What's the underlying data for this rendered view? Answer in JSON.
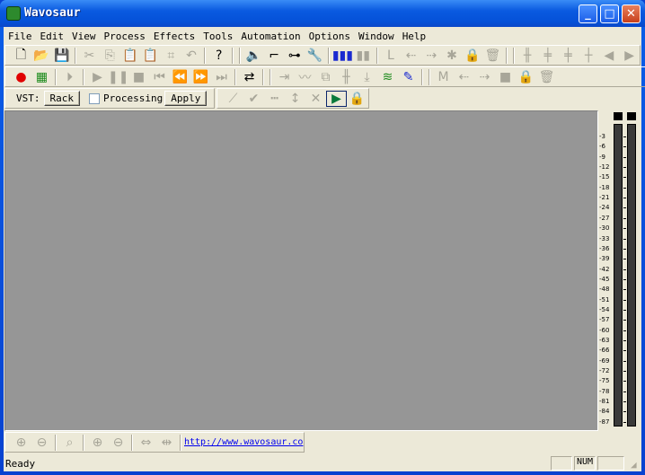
{
  "window": {
    "title": "Wavosaur",
    "minimize": "_",
    "maximize": "□",
    "close": "✕"
  },
  "menu": [
    "File",
    "Edit",
    "View",
    "Process",
    "Effects",
    "Tools",
    "Automation",
    "Options",
    "Window",
    "Help"
  ],
  "toolbar1": [
    {
      "name": "new-file-icon",
      "g": "🗋",
      "on": true
    },
    {
      "name": "open-folder-icon",
      "g": "📂",
      "on": true
    },
    {
      "name": "save-icon",
      "g": "💾"
    },
    "|",
    {
      "name": "cut-icon",
      "g": "✂"
    },
    {
      "name": "copy-icon",
      "g": "⎘"
    },
    {
      "name": "paste-icon",
      "g": "📋"
    },
    {
      "name": "paste-new-icon",
      "g": "📋"
    },
    {
      "name": "crop-icon",
      "g": "⌗"
    },
    {
      "name": "undo-icon",
      "g": "↶"
    },
    "|",
    {
      "name": "help-icon",
      "g": "?",
      "on": true
    },
    "||",
    {
      "name": "speaker-icon",
      "g": "🔈",
      "on": true
    },
    {
      "name": "routing-icon",
      "g": "⌐",
      "on": true
    },
    {
      "name": "connect-icon",
      "g": "⊶",
      "on": true
    },
    {
      "name": "wrench-icon",
      "g": "🔧",
      "on": true
    },
    "|",
    {
      "name": "waveform-icon",
      "g": "▮▮▮",
      "on": true
    },
    {
      "name": "waveform-gray-icon",
      "g": "▮▮"
    },
    "|",
    {
      "name": "loop-start-icon",
      "g": "L"
    },
    {
      "name": "loop-start-left-icon",
      "g": "⇠"
    },
    {
      "name": "loop-start-right-icon",
      "g": "⇢"
    },
    {
      "name": "loop-wave-icon",
      "g": "✱"
    },
    {
      "name": "lock-icon",
      "g": "🔒",
      "on": true
    },
    {
      "name": "trash-icon",
      "g": "🗑"
    },
    "||",
    {
      "name": "split-icon",
      "g": "╫"
    },
    {
      "name": "marker-icon",
      "g": "╪"
    },
    {
      "name": "marker2-icon",
      "g": "╪"
    },
    {
      "name": "marker3-icon",
      "g": "┼"
    },
    {
      "name": "prev-icon",
      "g": "◀"
    },
    {
      "name": "next-icon",
      "g": "▶"
    }
  ],
  "toolbar2": [
    {
      "name": "record-icon",
      "g": "●",
      "on": true
    },
    {
      "name": "level-meter-icon",
      "g": "▦",
      "on": true
    },
    "|",
    {
      "name": "play-from-start-icon",
      "g": "⏵"
    },
    "|",
    {
      "name": "play-icon",
      "g": "▶"
    },
    {
      "name": "pause-icon",
      "g": "❚❚"
    },
    {
      "name": "stop-icon",
      "g": "■"
    },
    {
      "name": "go-start-icon",
      "g": "⏮"
    },
    {
      "name": "rewind-icon",
      "g": "⏪"
    },
    {
      "name": "fast-forward-icon",
      "g": "⏩"
    },
    {
      "name": "go-end-icon",
      "g": "⏭"
    },
    "|",
    {
      "name": "loop-icon",
      "g": "⇄",
      "on": true
    },
    "||",
    {
      "name": "insert-icon",
      "g": "⇥"
    },
    {
      "name": "envelope-icon",
      "g": "〰"
    },
    {
      "name": "mix-icon",
      "g": "⧉"
    },
    {
      "name": "wave-split-icon",
      "g": "╫"
    },
    {
      "name": "normalize-icon",
      "g": "⤓"
    },
    {
      "name": "spectrum-icon",
      "g": "≋",
      "on": true
    },
    {
      "name": "pencil-icon",
      "g": "✎",
      "on": true
    },
    "||",
    {
      "name": "marker-m-icon",
      "g": "M"
    },
    {
      "name": "marker-left-icon",
      "g": "⇠"
    },
    {
      "name": "marker-right-icon",
      "g": "⇢"
    },
    {
      "name": "marker-block-icon",
      "g": "■"
    },
    {
      "name": "lock-icon",
      "g": "🔒",
      "on": true
    },
    {
      "name": "trash-icon",
      "g": "🗑"
    }
  ],
  "vst": {
    "label": "VST:",
    "rack": "Rack",
    "processing": "Processing",
    "apply": "Apply"
  },
  "toolbar3": [
    {
      "name": "curve-icon",
      "g": "⟋"
    },
    {
      "name": "check-icon",
      "g": "✔"
    },
    {
      "name": "dots-icon",
      "g": "┅"
    },
    {
      "name": "updown-icon",
      "g": "↕"
    },
    {
      "name": "delete-x-icon",
      "g": "✕"
    },
    {
      "name": "vst-play-icon",
      "g": "▶",
      "on": true
    },
    {
      "name": "lock-icon",
      "g": "🔒",
      "on": true
    }
  ],
  "meter": {
    "labels": [
      "-3",
      "-6",
      "-9",
      "-12",
      "-15",
      "-18",
      "-21",
      "-24",
      "-27",
      "-30",
      "-33",
      "-36",
      "-39",
      "-42",
      "-45",
      "-48",
      "-51",
      "-54",
      "-57",
      "-60",
      "-63",
      "-66",
      "-69",
      "-72",
      "-75",
      "-78",
      "-81",
      "-84",
      "-87"
    ]
  },
  "zoombar": [
    {
      "name": "zoom-in-icon",
      "g": "⊕"
    },
    {
      "name": "zoom-out-icon",
      "g": "⊖"
    },
    "|",
    {
      "name": "zoom-fit-icon",
      "g": "⌕"
    },
    "|",
    {
      "name": "zoom-in-vertical-icon",
      "g": "⊕"
    },
    {
      "name": "zoom-out-vertical-icon",
      "g": "⊖"
    },
    "|",
    {
      "name": "zoom-x2-icon",
      "g": "⇔"
    },
    {
      "name": "zoom-half-icon",
      "g": "⇹"
    }
  ],
  "link": "http://www.wavosaur.co",
  "status": {
    "text": "Ready",
    "num": "NUM"
  }
}
